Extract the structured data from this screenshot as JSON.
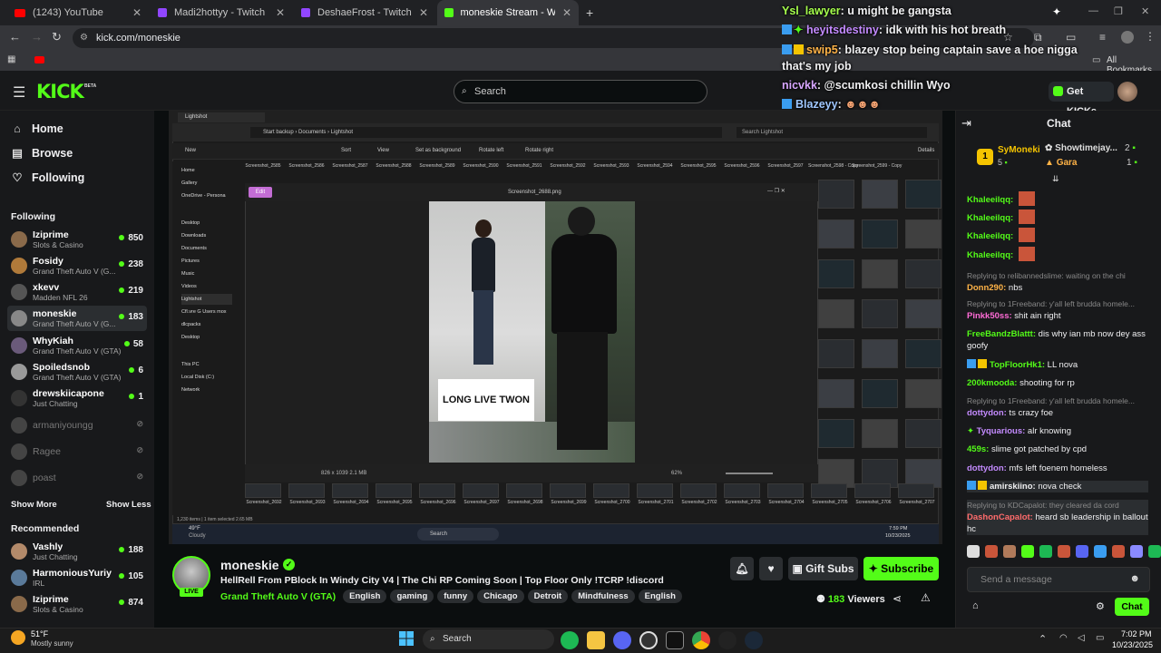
{
  "browser": {
    "tabs": [
      {
        "title": "(1243) YouTube",
        "icon": "youtube-icon",
        "color": "#ff0000"
      },
      {
        "title": "Madi2hottyy - Twitch",
        "icon": "twitch-icon",
        "color": "#9146ff"
      },
      {
        "title": "DeshaeFrost - Twitch",
        "icon": "twitch-icon",
        "color": "#9146ff"
      },
      {
        "title": "moneskie Stream - Watch Liv",
        "icon": "kick-icon",
        "color": "#53fc18"
      }
    ],
    "url": "kick.com/moneskie",
    "bookmarks_label": "All Bookmarks"
  },
  "overlay_chat": [
    {
      "user": "Ysl_lawyer",
      "text": ": u might be gangsta",
      "color": "#a6ff4d"
    },
    {
      "user": "heyitsdestiny",
      "text": ": idk with his hot breath",
      "color": "#c48bff"
    },
    {
      "user": "swip5",
      "text": ": blazey stop being captain save a hoe nigga that's my job",
      "color": "#ffb347"
    },
    {
      "user": "nicvkk",
      "text": ": @scumkosi chillin Wyo",
      "color": "#d8a6ff"
    },
    {
      "user": "Blazeyy",
      "text": ":",
      "color": "#9fc7ff"
    }
  ],
  "kick": {
    "logo": "KICK",
    "beta": "BETA",
    "search_placeholder": "Search",
    "get_kicks": "Get KICKs",
    "nav": [
      {
        "label": "Home",
        "icon": "home-icon"
      },
      {
        "label": "Browse",
        "icon": "browse-icon"
      },
      {
        "label": "Following",
        "icon": "heart-icon"
      }
    ],
    "following_title": "Following",
    "following": [
      {
        "name": "Iziprime",
        "game": "Slots & Casino",
        "viewers": "850",
        "online": true,
        "color": "#8a6a4a"
      },
      {
        "name": "Fosidy",
        "game": "Grand Theft Auto V (G...",
        "viewers": "238",
        "online": true,
        "color": "#b07a3a"
      },
      {
        "name": "xkevv",
        "game": "Madden NFL 26",
        "viewers": "219",
        "online": true,
        "color": "#555"
      },
      {
        "name": "moneskie",
        "game": "Grand Theft Auto V (G...",
        "viewers": "183",
        "online": true,
        "color": "#888"
      },
      {
        "name": "WhyKiah",
        "game": "Grand Theft Auto V (GTA)",
        "viewers": "58",
        "online": true,
        "color": "#6a5a7a"
      },
      {
        "name": "Spoiledsnob",
        "game": "Grand Theft Auto V (GTA)",
        "viewers": "6",
        "online": true,
        "color": "#999"
      },
      {
        "name": "drewskiicapone",
        "game": "Just Chatting",
        "viewers": "1",
        "online": true,
        "color": "#333"
      },
      {
        "name": "armaniyoungg",
        "game": "",
        "viewers": "",
        "online": false,
        "color": "#444"
      },
      {
        "name": "Ragee",
        "game": "",
        "viewers": "",
        "online": false,
        "color": "#444"
      },
      {
        "name": "poast",
        "game": "",
        "viewers": "",
        "online": false,
        "color": "#444"
      }
    ],
    "show_more": "Show More",
    "show_less": "Show Less",
    "recommended_title": "Recommended",
    "recommended": [
      {
        "name": "Vashly",
        "game": "Just Chatting",
        "viewers": "188",
        "color": "#b38a6a"
      },
      {
        "name": "HarmoniousYuriy",
        "game": "IRL",
        "viewers": "105",
        "color": "#5a7a9a"
      },
      {
        "name": "Iziprime",
        "game": "Slots & Casino",
        "viewers": "874",
        "color": "#8a6a4a"
      }
    ]
  },
  "explorer": {
    "tab_title": "Lightshot",
    "breadcrumb": [
      "Start backup",
      "Documents",
      "Lightshot"
    ],
    "search": "Search Lightshot",
    "toolbar": [
      "New",
      "Sort",
      "View",
      "Set as background",
      "Rotate left",
      "Rotate right",
      "Details"
    ],
    "tree": [
      "Home",
      "Gallery",
      "OneDrive - Persona",
      "Desktop",
      "Downloads",
      "Documents",
      "Pictures",
      "Music",
      "Videos",
      "Lightshot",
      "Cfl.vre G Users mox",
      "dlcpacks",
      "Desktop",
      "This PC",
      "Local Disk (C:)",
      "Network"
    ],
    "top_labels": [
      "Screenshot_2585",
      "Screenshot_2586",
      "Screenshot_2587",
      "Screenshot_2588",
      "Screenshot_2589",
      "Screenshot_2590",
      "Screenshot_2591",
      "Screenshot_2592",
      "Screenshot_2593",
      "Screenshot_2594",
      "Screenshot_2595",
      "Screenshot_2596",
      "Screenshot_2597",
      "Screenshot_2598 - Copy",
      "Screenshot_2599 - Copy"
    ],
    "bottom_labels": [
      "Screenshot_2692",
      "Screenshot_2693",
      "Screenshot_2694",
      "Screenshot_2695",
      "Screenshot_2696",
      "Screenshot_2697",
      "Screenshot_2698",
      "Screenshot_2699",
      "Screenshot_2700",
      "Screenshot_2701",
      "Screenshot_2702",
      "Screenshot_2703",
      "Screenshot_2704",
      "Screenshot_2705",
      "Screenshot_2706",
      "Screenshot_2707"
    ],
    "status": "1,230 items  |  1 item selected  2.65 MB",
    "photo_title": "Screenshot_2688.png",
    "photo_edit": "Edit",
    "photo_info": "826 x 1039   2.1 MB",
    "zoom": "62%",
    "sign_text": "LONG LIVE TWON",
    "win_weather_temp": "49°F",
    "win_weather": "Cloudy",
    "win_search": "Search",
    "win_time": "7:59 PM",
    "win_date": "10/23/2025"
  },
  "stream": {
    "name": "moneskie",
    "live": "LIVE",
    "title": "HellRell From PBlock In Windy City V4 | The Chi RP Coming Soon | Top Floor Only !TCRP !discord",
    "category": "Grand Theft Auto V (GTA)",
    "tags": [
      "English",
      "gaming",
      "funny",
      "Chicago",
      "Detroit",
      "Mindfulness",
      "English"
    ],
    "gift_subs": "Gift Subs",
    "subscribe": "Subscribe",
    "viewers": "183",
    "viewers_label": "Viewers"
  },
  "chat": {
    "title": "Chat",
    "leaders": [
      {
        "name": "SyMoneki",
        "count": "5",
        "rank": "1"
      },
      {
        "name": "Showtimejay...",
        "count": "2"
      },
      {
        "name": "Gara",
        "count": "1"
      }
    ],
    "messages": [
      {
        "user": "Khaleeilqq:",
        "text": "",
        "color": "#53fc18"
      },
      {
        "user": "Khaleeilqq:",
        "text": "",
        "color": "#53fc18"
      },
      {
        "user": "Khaleeilqq:",
        "text": "",
        "color": "#53fc18"
      },
      {
        "user": "Khaleeilqq:",
        "text": "",
        "color": "#53fc18"
      },
      {
        "reply": "Replying to relibannedslime: waiting on the chi",
        "user": "Donn290:",
        "text": " nbs",
        "color": "#ffb347"
      },
      {
        "reply": "Replying to 1Freeband: y'all left brudda homele...",
        "user": "Pinkk50ss:",
        "text": " shit ain right",
        "color": "#ff6bd6"
      },
      {
        "user": "FreeBandzBlattt:",
        "text": " dis why ian mb now dey ass goofy",
        "color": "#53fc18"
      },
      {
        "user": "TopFloorHk1:",
        "text": " LL nova",
        "color": "#53fc18"
      },
      {
        "user": "200kmooda:",
        "text": " shooting for rp",
        "color": "#53fc18"
      },
      {
        "reply": "Replying to 1Freeband: y'all left brudda homele...",
        "user": "dottydon:",
        "text": " ts crazy foe",
        "color": "#c48bff"
      },
      {
        "user": "Tyquarious:",
        "text": " alr knowing",
        "color": "#c48bff"
      },
      {
        "user": "459s:",
        "text": " slime got patched by cpd",
        "color": "#53fc18"
      },
      {
        "user": "dottydon:",
        "text": " mfs left foenem homeless",
        "color": "#c48bff"
      },
      {
        "user": "amirskiino:",
        "text": " nova check",
        "color": "#efeff1"
      },
      {
        "reply": "Replying to KDCapalot: they cleared da cord",
        "user": "DashonCapalot:",
        "text": " heard sb leadership in ballout hc",
        "color": "#ff6b6b"
      }
    ],
    "placeholder": "Send a message",
    "send": "Chat"
  },
  "taskbar": {
    "temp": "51°F",
    "weather": "Mostly sunny",
    "search": "Search",
    "time": "7:02 PM",
    "date": "10/23/2025"
  }
}
